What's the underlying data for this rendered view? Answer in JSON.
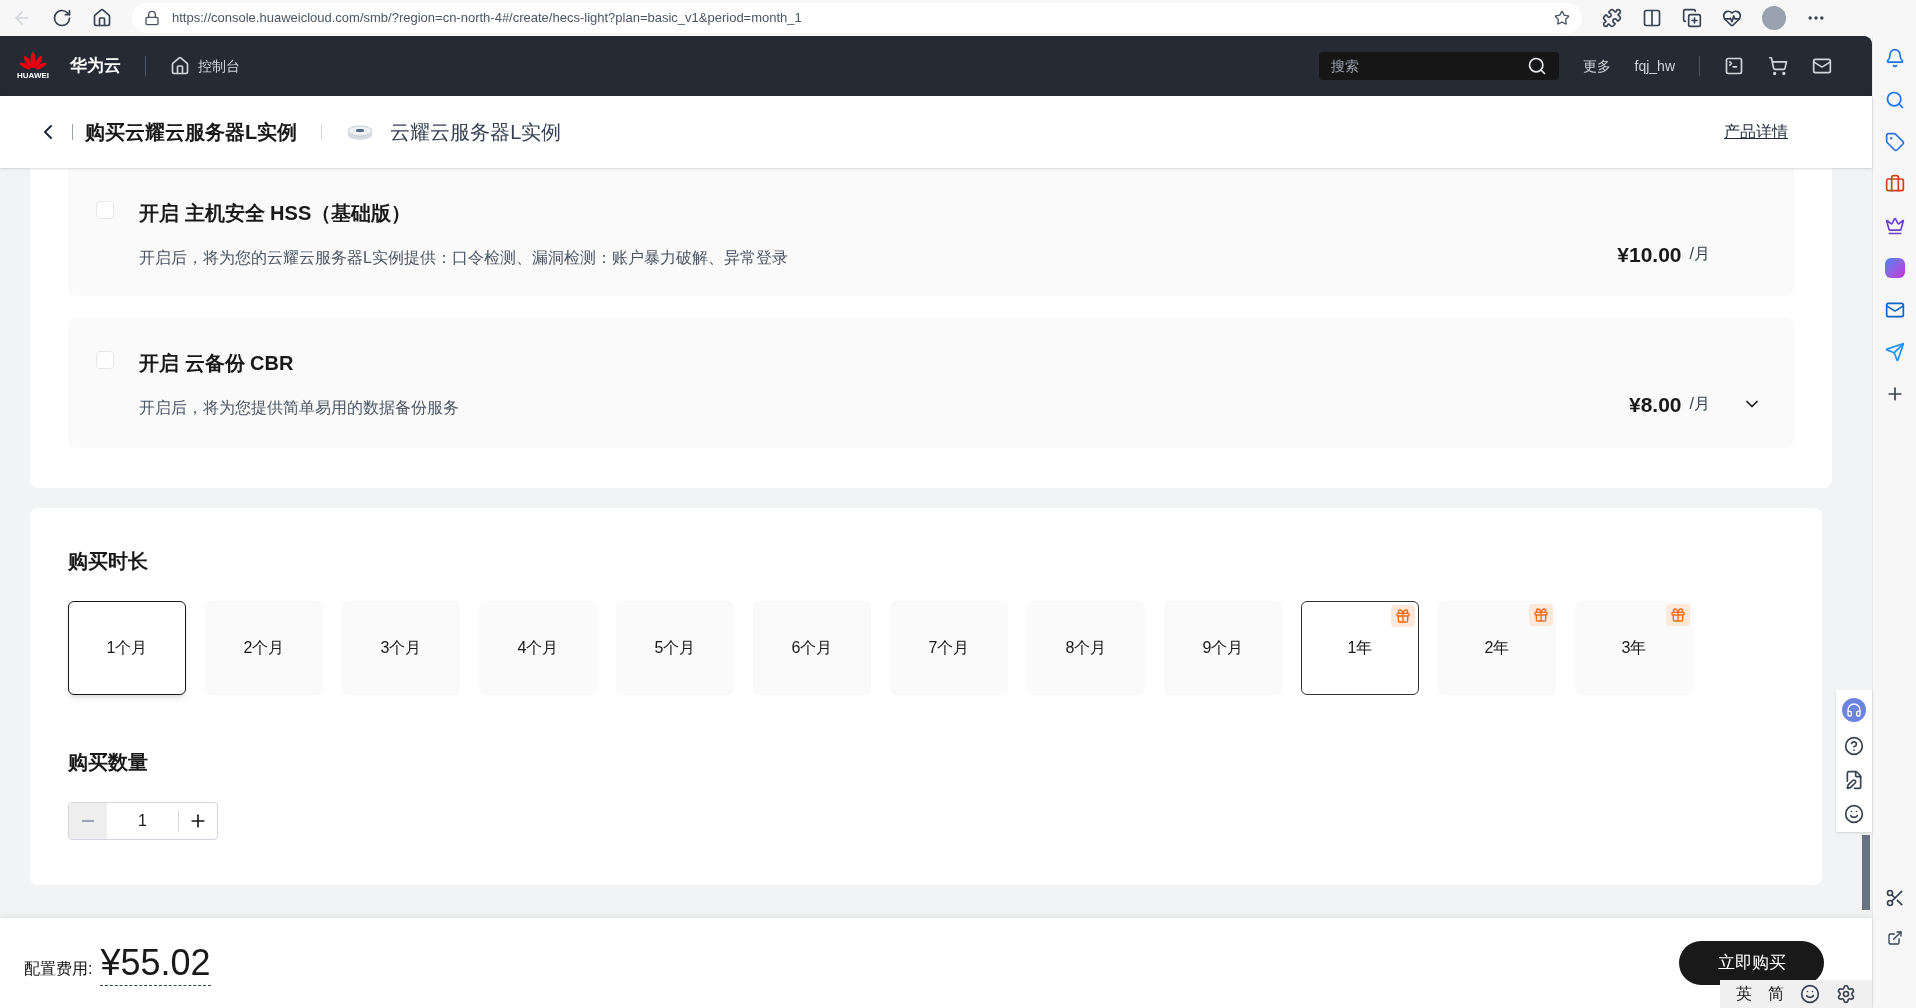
{
  "browser": {
    "url": "https://console.huaweicloud.com/smb/?region=cn-north-4#/create/hecs-light?plan=basic_v1&period=month_1"
  },
  "header": {
    "brand": "华为云",
    "logo_text": "HUAWEI",
    "console": "控制台",
    "search": {
      "placeholder": "搜索"
    },
    "more": "更多",
    "user": "fqj_hw"
  },
  "page_header": {
    "title": "购买云耀云服务器L实例",
    "product": "云耀云服务器L实例",
    "details_link": "产品详情"
  },
  "addons": [
    {
      "title": "开启 主机安全 HSS（基础版）",
      "description": "开启后，将为您的云耀云服务器L实例提供：口令检测、漏洞检测：账户暴力破解、异常登录",
      "price": "¥10.00",
      "unit": "/月",
      "checked": false,
      "expandable": false
    },
    {
      "title": "开启 云备份 CBR",
      "description": "开启后，将为您提供简单易用的数据备份服务",
      "price": "¥8.00",
      "unit": "/月",
      "checked": false,
      "expandable": true
    }
  ],
  "duration": {
    "title": "购买时长",
    "options": [
      {
        "label": "1个月",
        "selected": true,
        "hovered": false,
        "gift": false
      },
      {
        "label": "2个月",
        "selected": false,
        "hovered": false,
        "gift": false
      },
      {
        "label": "3个月",
        "selected": false,
        "hovered": false,
        "gift": false
      },
      {
        "label": "4个月",
        "selected": false,
        "hovered": false,
        "gift": false
      },
      {
        "label": "5个月",
        "selected": false,
        "hovered": false,
        "gift": false
      },
      {
        "label": "6个月",
        "selected": false,
        "hovered": false,
        "gift": false
      },
      {
        "label": "7个月",
        "selected": false,
        "hovered": false,
        "gift": false
      },
      {
        "label": "8个月",
        "selected": false,
        "hovered": false,
        "gift": false
      },
      {
        "label": "9个月",
        "selected": false,
        "hovered": false,
        "gift": false
      },
      {
        "label": "1年",
        "selected": false,
        "hovered": true,
        "gift": true
      },
      {
        "label": "2年",
        "selected": false,
        "hovered": false,
        "gift": true
      },
      {
        "label": "3年",
        "selected": false,
        "hovered": false,
        "gift": true
      }
    ]
  },
  "quantity": {
    "title": "购买数量",
    "value": "1",
    "decrement_disabled": true
  },
  "footer": {
    "cost_label": "配置费用:",
    "cost": "¥55.02",
    "buy_button": "立即购买"
  },
  "ime": {
    "mode": "英",
    "charset": "简"
  }
}
